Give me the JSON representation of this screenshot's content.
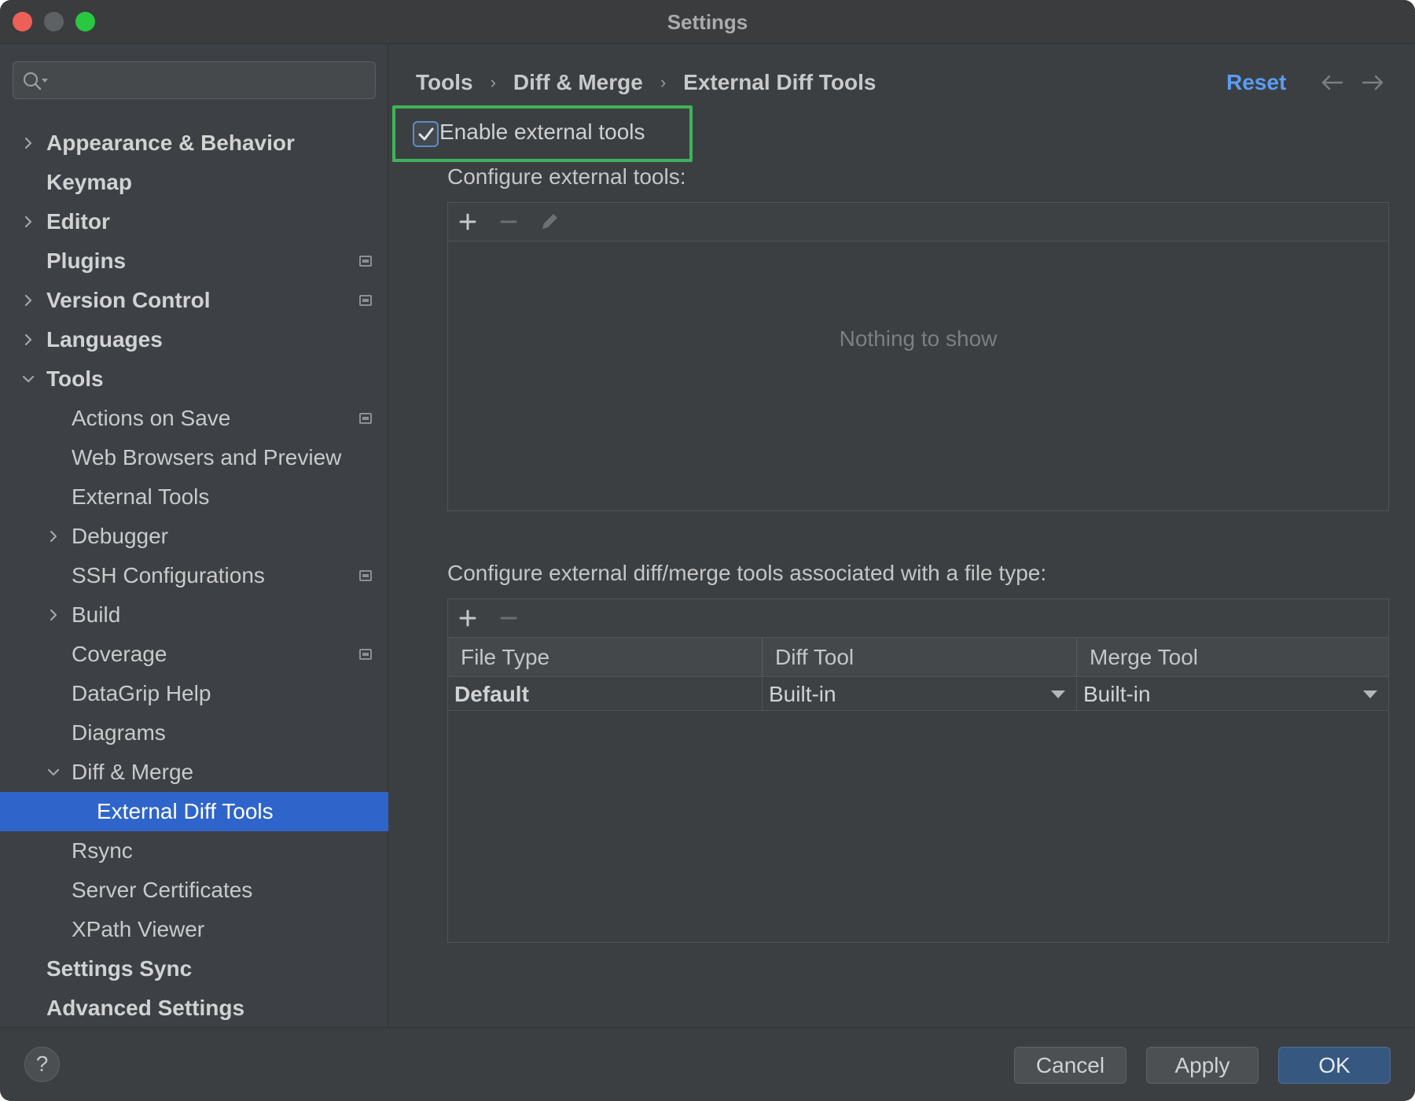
{
  "window": {
    "title": "Settings"
  },
  "search": {
    "placeholder": ""
  },
  "sidebar": {
    "items": [
      {
        "label": "Appearance & Behavior",
        "level": 0,
        "bold": true,
        "chevron": "right",
        "badge": false
      },
      {
        "label": "Keymap",
        "level": 0,
        "bold": true,
        "chevron": "none",
        "badge": false
      },
      {
        "label": "Editor",
        "level": 0,
        "bold": true,
        "chevron": "right",
        "badge": false
      },
      {
        "label": "Plugins",
        "level": 0,
        "bold": true,
        "chevron": "none",
        "badge": true
      },
      {
        "label": "Version Control",
        "level": 0,
        "bold": true,
        "chevron": "right",
        "badge": true
      },
      {
        "label": "Languages",
        "level": 0,
        "bold": true,
        "chevron": "right",
        "badge": false
      },
      {
        "label": "Tools",
        "level": 0,
        "bold": true,
        "chevron": "down",
        "badge": false
      },
      {
        "label": "Actions on Save",
        "level": 1,
        "bold": false,
        "chevron": "none",
        "badge": true
      },
      {
        "label": "Web Browsers and Preview",
        "level": 1,
        "bold": false,
        "chevron": "none",
        "badge": false
      },
      {
        "label": "External Tools",
        "level": 1,
        "bold": false,
        "chevron": "none",
        "badge": false
      },
      {
        "label": "Debugger",
        "level": 1,
        "bold": false,
        "chevron": "right",
        "badge": false
      },
      {
        "label": "SSH Configurations",
        "level": 1,
        "bold": false,
        "chevron": "none",
        "badge": true
      },
      {
        "label": "Build",
        "level": 1,
        "bold": false,
        "chevron": "right",
        "badge": false
      },
      {
        "label": "Coverage",
        "level": 1,
        "bold": false,
        "chevron": "none",
        "badge": true
      },
      {
        "label": "DataGrip Help",
        "level": 1,
        "bold": false,
        "chevron": "none",
        "badge": false
      },
      {
        "label": "Diagrams",
        "level": 1,
        "bold": false,
        "chevron": "none",
        "badge": false
      },
      {
        "label": "Diff & Merge",
        "level": 1,
        "bold": false,
        "chevron": "down",
        "badge": false
      },
      {
        "label": "External Diff Tools",
        "level": 2,
        "bold": false,
        "chevron": "none",
        "badge": false,
        "selected": true
      },
      {
        "label": "Rsync",
        "level": 1,
        "bold": false,
        "chevron": "none",
        "badge": false
      },
      {
        "label": "Server Certificates",
        "level": 1,
        "bold": false,
        "chevron": "none",
        "badge": false
      },
      {
        "label": "XPath Viewer",
        "level": 1,
        "bold": false,
        "chevron": "none",
        "badge": false
      },
      {
        "label": "Settings Sync",
        "level": 0,
        "bold": true,
        "chevron": "none",
        "badge": false
      },
      {
        "label": "Advanced Settings",
        "level": 0,
        "bold": true,
        "chevron": "none",
        "badge": false
      }
    ]
  },
  "breadcrumb": {
    "items": [
      "Tools",
      "Diff & Merge",
      "External Diff Tools"
    ]
  },
  "header": {
    "reset_label": "Reset"
  },
  "enable_tools": {
    "label": "Enable external tools",
    "checked": true
  },
  "external_tools": {
    "label": "Configure external tools:",
    "empty_text": "Nothing to show"
  },
  "file_type_tools": {
    "label": "Configure external diff/merge tools associated with a file type:",
    "columns": [
      "File Type",
      "Diff Tool",
      "Merge Tool"
    ],
    "rows": [
      {
        "file_type": "Default",
        "diff_tool": "Built-in",
        "merge_tool": "Built-in"
      }
    ]
  },
  "footer": {
    "help_label": "?",
    "cancel_label": "Cancel",
    "apply_label": "Apply",
    "ok_label": "OK"
  },
  "colors": {
    "accent": "#2f65ca",
    "link": "#589df6",
    "highlight_border": "#3fb35b",
    "primary_button": "#365880"
  }
}
